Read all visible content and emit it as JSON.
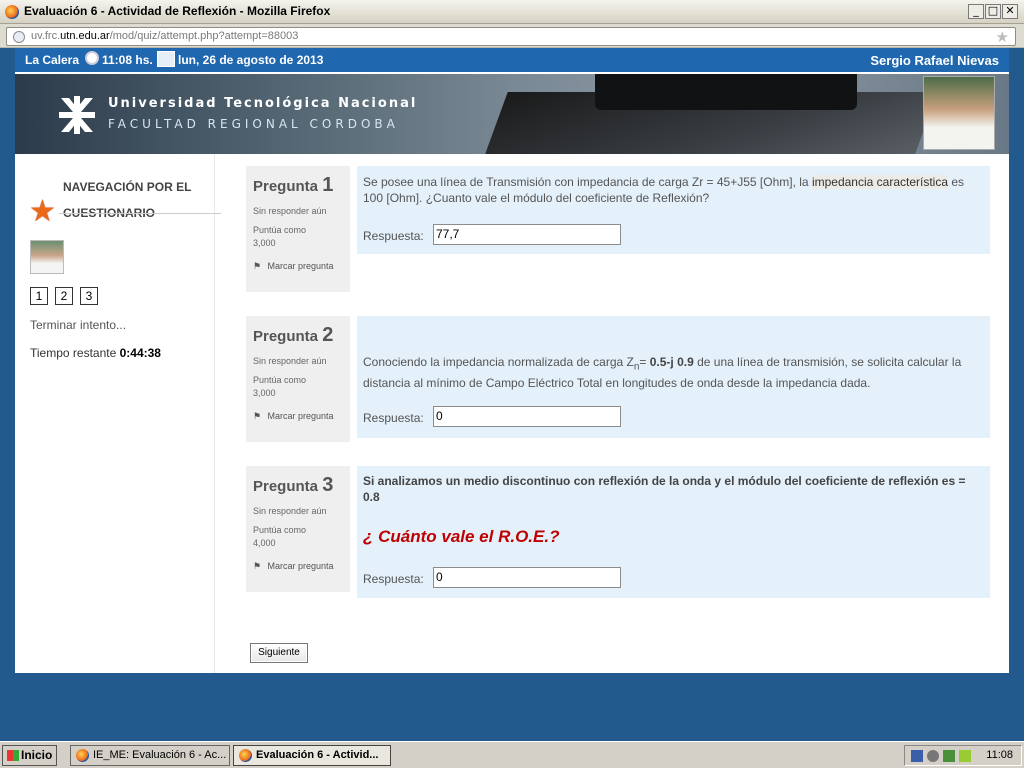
{
  "window": {
    "title": "Evaluación 6 - Actividad de Reflexión - Mozilla Firefox"
  },
  "urlbar": {
    "url_prefix": "uv.frc.",
    "url_domain": "utn.edu.ar",
    "url_path": "/mod/quiz/attempt.php?attempt=88003"
  },
  "topbar": {
    "location": "La Calera",
    "time": "11:08 hs.",
    "date": "lun, 26 de agosto de 2013",
    "user": "Sergio Rafael Nievas"
  },
  "banner": {
    "university": "Universidad Tecnológica Nacional",
    "faculty": "FACULTAD REGIONAL CORDOBA"
  },
  "nav": {
    "title_line1": "NAVEGACIÓN POR EL",
    "title_line2": "CUESTIONARIO",
    "questions": [
      "1",
      "2",
      "3"
    ],
    "finish": "Terminar intento...",
    "remaining_label": "Tiempo restante",
    "remaining_value": "0:44:38"
  },
  "questions": [
    {
      "label": "Pregunta",
      "number": "1",
      "status": "Sin responder aún",
      "grade_label": "Puntúa como",
      "grade": "3,000",
      "flag": "Marcar pregunta",
      "text_a": "Se posee una línea de Transmisión con impedancia de carga Zr = 45+J55 [Ohm], la ",
      "text_hl": "impedancia característica",
      "text_b": " es 100 [Ohm]. ¿Cuanto vale el módulo del coeficiente de Reflexión?",
      "answer_label": "Respuesta:",
      "answer": "77,7"
    },
    {
      "label": "Pregunta",
      "number": "2",
      "status": "Sin responder aún",
      "grade_label": "Puntúa como",
      "grade": "3,000",
      "flag": "Marcar pregunta",
      "text_a": "Conociendo la impedancia normalizada de carga Z",
      "text_sub": "n",
      "text_eq": "= ",
      "text_bold": "0.5-j 0.9",
      "text_b": " de una línea de transmisión, se solicita calcular la distancia al mínimo de Campo Eléctrico Total en longitudes de onda desde la impedancia dada.",
      "answer_label": "Respuesta:",
      "answer": "0"
    },
    {
      "label": "Pregunta",
      "number": "3",
      "status": "Sin responder aún",
      "grade_label": "Puntúa como",
      "grade": "4,000",
      "flag": "Marcar pregunta",
      "text_bold": "Si analizamos un medio discontinuo con reflexión de la onda y  el módulo del coeficiente de reflexión es = 0.8",
      "text_red": "¿ Cuánto vale el R.O.E.?",
      "answer_label": "Respuesta:",
      "answer": "0"
    }
  ],
  "next_button": "Siguiente",
  "taskbar": {
    "start": "Inicio",
    "tasks": [
      "IE_ME: Evaluación 6 - Ac...",
      "Evaluación 6 - Activid..."
    ],
    "clock": "11:08"
  }
}
